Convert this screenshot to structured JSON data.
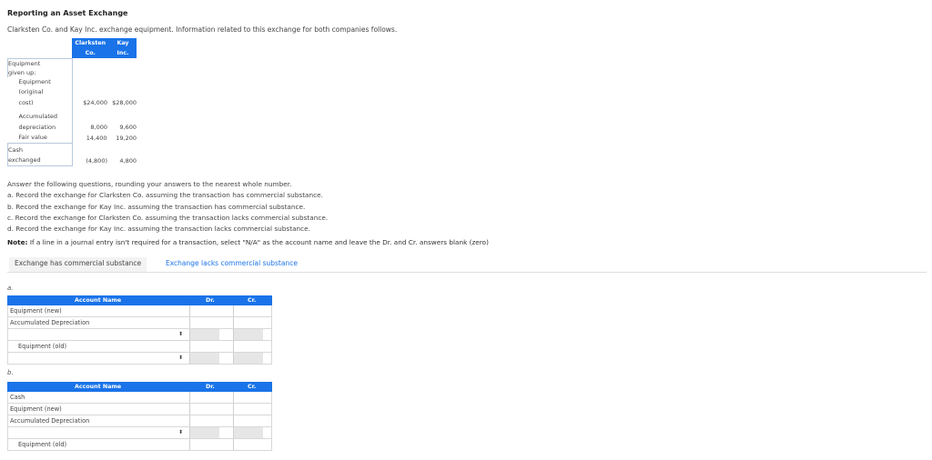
{
  "title": "Reporting an Asset Exchange",
  "intro": "Clarksten Co. and Kay Inc. exchange equipment. Information related to this exchange for both companies follows.",
  "info_table": {
    "headers": [
      "Clarksten Co.",
      "Kay Inc."
    ],
    "group_label_1": "Equipment",
    "group_label_2": "given up:",
    "rows": [
      {
        "label_lines": [
          "Equipment",
          "(original",
          "cost)"
        ],
        "clarksten": "$24,000",
        "kay": "$28,000"
      },
      {
        "label_lines": [
          "Accumulated",
          "depreciation"
        ],
        "clarksten": "8,000",
        "kay": "9,600"
      },
      {
        "label_lines": [
          "Fair value"
        ],
        "clarksten": "14,400",
        "kay": "19,200"
      },
      {
        "label_lines": [
          "Cash",
          "exchanged"
        ],
        "clarksten": "(4,800)",
        "kay": "4,800"
      }
    ]
  },
  "questions": {
    "lead": "Answer the following questions, rounding your answers to the nearest whole number.",
    "a": "a. Record the exchange for Clarksten Co. assuming the transaction has commercial substance.",
    "b": "b. Record the exchange for Kay Inc. assuming the transaction has commercial substance.",
    "c": "c. Record the exchange for Clarksten Co. assuming the transaction lacks commercial substance.",
    "d": "d. Record the exchange for Kay Inc. assuming the transaction lacks commercial substance."
  },
  "note": {
    "label": "Note:",
    "text": "If a line in a journal entry isn't required for a transaction, select \"N/A\" as the account name and leave the Dr. and Cr. answers blank (zero)"
  },
  "tabs": [
    "Exchange has commercial substance",
    "Exchange lacks commercial substance"
  ],
  "part_a": {
    "label": "a.",
    "header": {
      "account": "Account Name",
      "dr": "Dr.",
      "cr": "Cr."
    },
    "rows": [
      "Equipment (new)",
      "Accumulated Depreciation",
      "",
      "Equipment (old)",
      ""
    ],
    "select_icon": "⬍"
  },
  "part_b": {
    "label": "b.",
    "header": {
      "account": "Account Name",
      "dr": "Dr.",
      "cr": "Cr."
    },
    "rows": [
      "Cash",
      "Equipment (new)",
      "Accumulated Depreciation",
      "",
      "Equipment (old)"
    ],
    "select_icon": "⬍"
  }
}
